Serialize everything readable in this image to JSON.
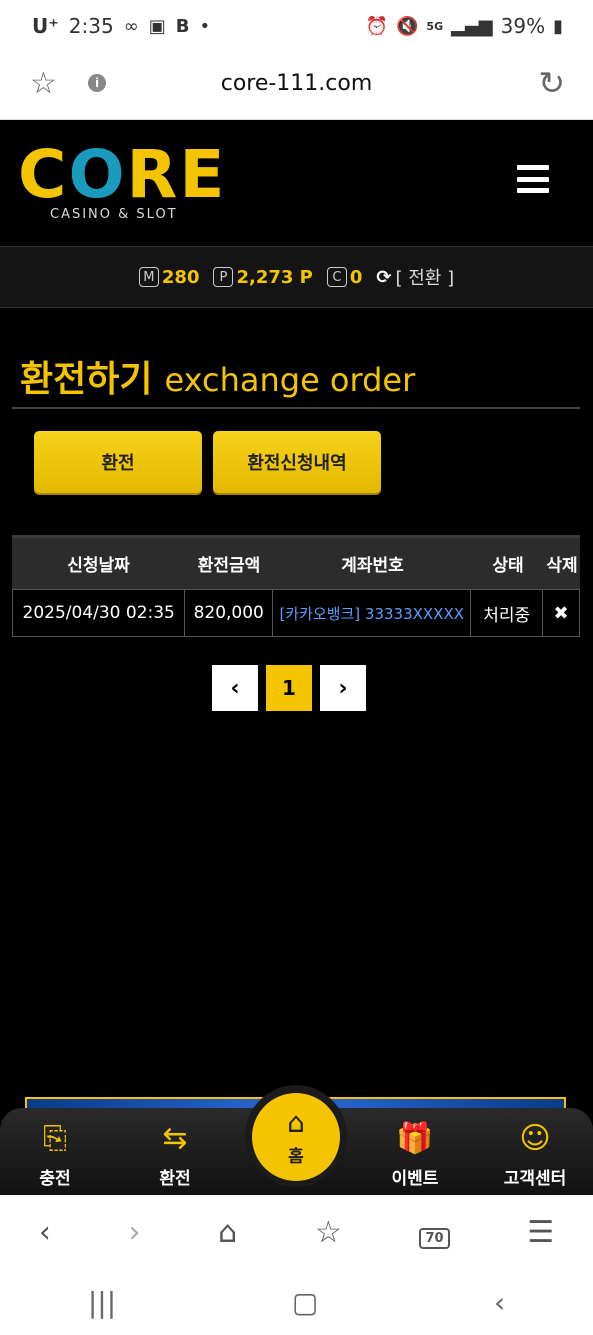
{
  "status_bar": {
    "carrier": "U⁺",
    "time": "2:35",
    "battery": "39%"
  },
  "browser": {
    "url": "core-111.com",
    "tabs_count": "70"
  },
  "header": {
    "logo_main": "CORE",
    "logo_sub": "CASINO & SLOT"
  },
  "balance": {
    "m_letter": "M",
    "m_value": "280",
    "p_letter": "P",
    "p_value": "2,273 P",
    "c_letter": "C",
    "c_value": "0",
    "switch_label": "[ 전환 ]"
  },
  "page": {
    "title_ko": "환전하기",
    "title_en": "exchange order"
  },
  "buttons": {
    "exchange": "환전",
    "history": "환전신청내역"
  },
  "table": {
    "headers": [
      "신청날짜",
      "환전금액",
      "계좌번호",
      "상태",
      "삭제"
    ],
    "rows": [
      {
        "date": "2025/04/30 02:35",
        "amount": "820,000",
        "account": "[카카오뱅크] 33333XXXXX",
        "status": "처리중"
      }
    ]
  },
  "pagination": {
    "current": "1"
  },
  "bottom_nav": {
    "charge": "충전",
    "exchange": "환전",
    "home": "홈",
    "event": "이벤트",
    "support": "고객센터"
  },
  "colors": {
    "accent": "#f5c400",
    "background": "#000000",
    "link": "#5b9cff"
  }
}
